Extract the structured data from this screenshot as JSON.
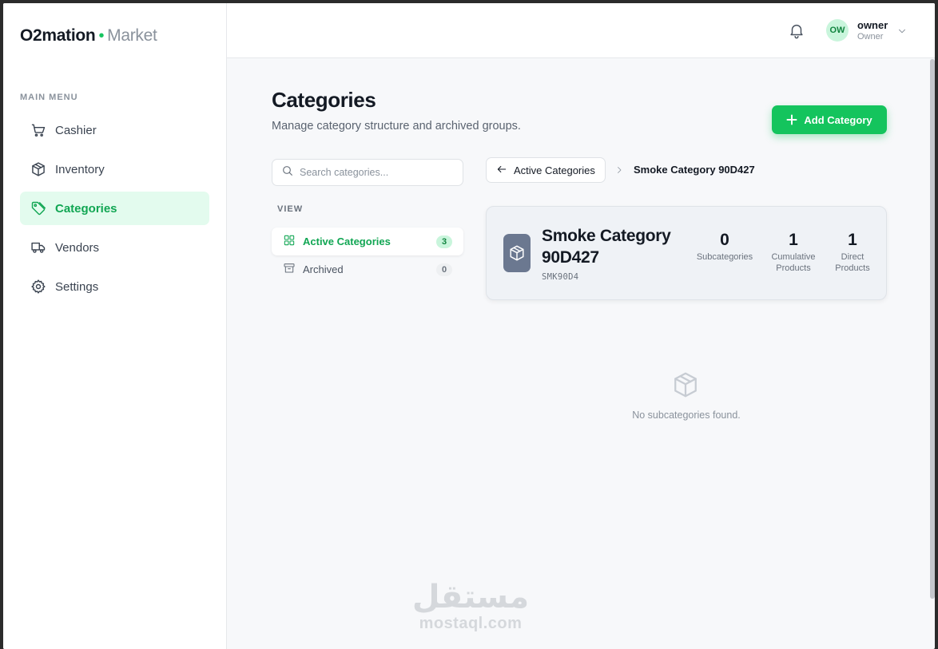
{
  "brand": {
    "name": "O2mation",
    "sub": "Market",
    "accent": "#17c460"
  },
  "sidebar": {
    "section_label": "MAIN MENU",
    "items": [
      {
        "label": "Cashier",
        "icon": "cart-icon",
        "active": false
      },
      {
        "label": "Inventory",
        "icon": "box-icon",
        "active": false
      },
      {
        "label": "Categories",
        "icon": "tag-icon",
        "active": true
      },
      {
        "label": "Vendors",
        "icon": "truck-icon",
        "active": false
      },
      {
        "label": "Settings",
        "icon": "gear-icon",
        "active": false
      }
    ]
  },
  "header": {
    "user": {
      "initials": "OW",
      "name": "owner",
      "role": "Owner"
    }
  },
  "main": {
    "title": "Categories",
    "subtitle": "Manage category structure and archived groups.",
    "add_button": "Add Category",
    "search_placeholder": "Search categories...",
    "view_label": "VIEW",
    "views": [
      {
        "label": "Active Categories",
        "count": "3",
        "active": true
      },
      {
        "label": "Archived",
        "count": "0",
        "active": false
      }
    ],
    "breadcrumb": {
      "back_label": "Active Categories",
      "current": "Smoke Category 90D427"
    },
    "card": {
      "title": "Smoke Category 90D427",
      "code": "SMK90D4",
      "stats": [
        {
          "value": "0",
          "label": "Subcategories"
        },
        {
          "value": "1",
          "label": "Cumulative Products"
        },
        {
          "value": "1",
          "label": "Direct Products"
        }
      ]
    },
    "empty_text": "No subcategories found."
  },
  "watermark": {
    "arabic": "مستقل",
    "latin": "mostaql.com"
  }
}
